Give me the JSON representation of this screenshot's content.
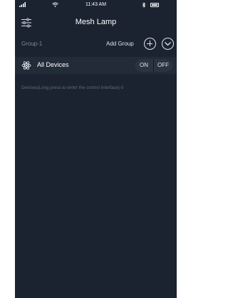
{
  "status_bar": {
    "signal_icon": "signal-bars-icon",
    "wifi_icon": "wifi-icon",
    "time": "11:43 AM",
    "bluetooth_icon": "bluetooth-icon",
    "battery_icon": "battery-icon"
  },
  "nav": {
    "menu_icon": "sliders-menu-icon",
    "title": "Mesh Lamp"
  },
  "group": {
    "name": "Group-1",
    "add_group_label": "Add Group",
    "add_icon": "plus-circle-icon",
    "collapse_icon": "chevron-down-circle-icon"
  },
  "all_devices": {
    "icon": "atom-icon",
    "label": "All Devices",
    "on_label": "ON",
    "off_label": "OFF"
  },
  "devices_hint": "Devices(Long press to enter the control interface)-0",
  "colors": {
    "background": "#1b2330",
    "row_background": "#222b38",
    "text_primary": "#ffffff",
    "text_muted": "#7b8696"
  }
}
